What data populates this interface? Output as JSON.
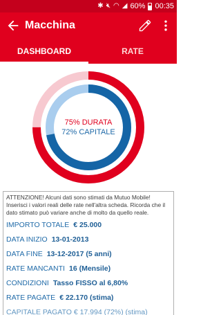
{
  "status_bar": {
    "battery": "60%",
    "time": "00:35"
  },
  "app_bar": {
    "title": "Macchina"
  },
  "tabs": [
    {
      "label": "DASHBOARD",
      "active": true
    },
    {
      "label": "RATE",
      "active": false
    }
  ],
  "progress": {
    "durata_percent": 75,
    "capitale_percent": 72,
    "durata_label": "75% DURATA",
    "capitale_label": "72% CAPITALE",
    "colors": {
      "durata": "#e0001e",
      "durata_track": "#f7c9d0",
      "capitale": "#1565a6",
      "capitale_track": "#a9cdee"
    }
  },
  "info": {
    "notice": "ATTENZIONE! Alcuni dati sono stimati da Mutuo Mobile! Inserisci i valori reali delle rate nell'altra scheda. Ricorda che il dato stimato può variare anche di molto da quello reale.",
    "rows": [
      {
        "label": "IMPORTO TOTALE",
        "value": "€ 25.000"
      },
      {
        "label": "DATA INIZIO",
        "value": "13-01-2013"
      },
      {
        "label": "DATA FINE",
        "value": "13-12-2017 (5 anni)"
      },
      {
        "label": "RATE MANCANTI",
        "value": "16 (Mensile)"
      },
      {
        "label": "CONDIZIONI",
        "value": "Tasso FISSO al 6,80%"
      },
      {
        "label": "RATE PAGATE",
        "value": "€ 22.170 (stima)"
      }
    ],
    "cut_row": "CAPITALE PAGATO € 17.994 (72%) (stima)"
  }
}
